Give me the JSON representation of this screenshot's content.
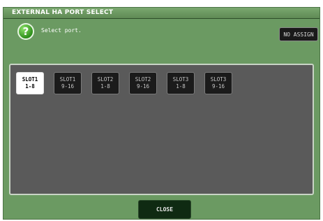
{
  "dialog": {
    "title": "EXTERNAL HA PORT SELECT",
    "prompt": "Select port.",
    "no_assign_label": "NO ASSIGN",
    "close_label": "CLOSE",
    "help_icon": "question-icon"
  },
  "slots": [
    {
      "line1": "SLOT1",
      "line2": "1-8",
      "selected": true
    },
    {
      "line1": "SLOT1",
      "line2": "9-16",
      "selected": false
    },
    {
      "line1": "SLOT2",
      "line2": "1-8",
      "selected": false
    },
    {
      "line1": "SLOT2",
      "line2": "9-16",
      "selected": false
    },
    {
      "line1": "SLOT3",
      "line2": "1-8",
      "selected": false
    },
    {
      "line1": "SLOT3",
      "line2": "9-16",
      "selected": false
    }
  ],
  "colors": {
    "dialog_bg": "#6b9a62",
    "panel_bg": "#5a5a5a",
    "selected_bg": "#ffffff",
    "button_bg": "#1b1b1b"
  }
}
